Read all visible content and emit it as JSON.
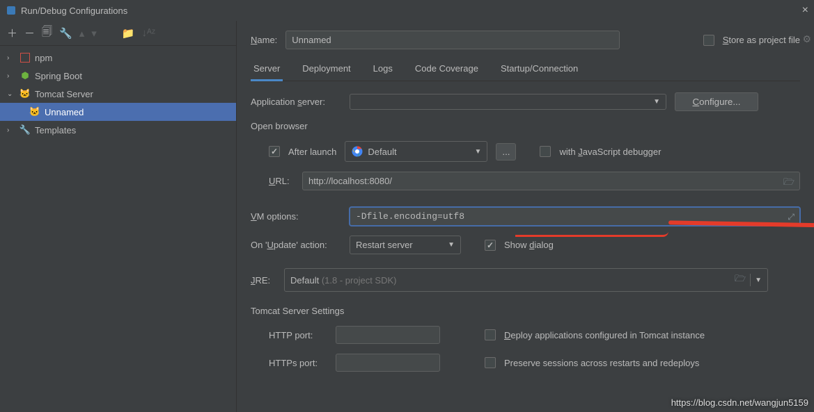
{
  "window": {
    "title": "Run/Debug Configurations"
  },
  "tree": {
    "items": [
      {
        "label": "npm",
        "icon": "npm"
      },
      {
        "label": "Spring Boot",
        "icon": "spring"
      },
      {
        "label": "Tomcat Server",
        "icon": "tomcat",
        "expanded": true
      },
      {
        "label": "Unnamed",
        "icon": "tomcat-run",
        "selected": true
      },
      {
        "label": "Templates",
        "icon": "wrench"
      }
    ]
  },
  "form": {
    "name_label": "Name:",
    "name_value": "Unnamed",
    "store_label": "Store as project file",
    "tabs": [
      "Server",
      "Deployment",
      "Logs",
      "Code Coverage",
      "Startup/Connection"
    ],
    "app_server_label": "Application server:",
    "app_server_value": "",
    "configure_btn": "Configure...",
    "open_browser_label": "Open browser",
    "after_launch_label": "After launch",
    "browser_value": "Default",
    "ellipsis": "...",
    "js_debugger_label": "with JavaScript debugger",
    "url_label": "URL:",
    "url_value": "http://localhost:8080/",
    "vm_label": "VM options:",
    "vm_value": "-Dfile.encoding=utf8",
    "on_update_label": "On 'Update' action:",
    "on_update_value": "Restart server",
    "show_dialog_label": "Show dialog",
    "jre_label": "JRE:",
    "jre_value": "Default",
    "jre_hint": "(1.8 - project SDK)",
    "tomcat_settings_label": "Tomcat Server Settings",
    "http_port_label": "HTTP port:",
    "https_port_label": "HTTPs port:",
    "deploy_apps_label": "Deploy applications configured in Tomcat instance",
    "preserve_sessions_label": "Preserve sessions across restarts and redeploys"
  },
  "watermark": "https://blog.csdn.net/wangjun5159"
}
